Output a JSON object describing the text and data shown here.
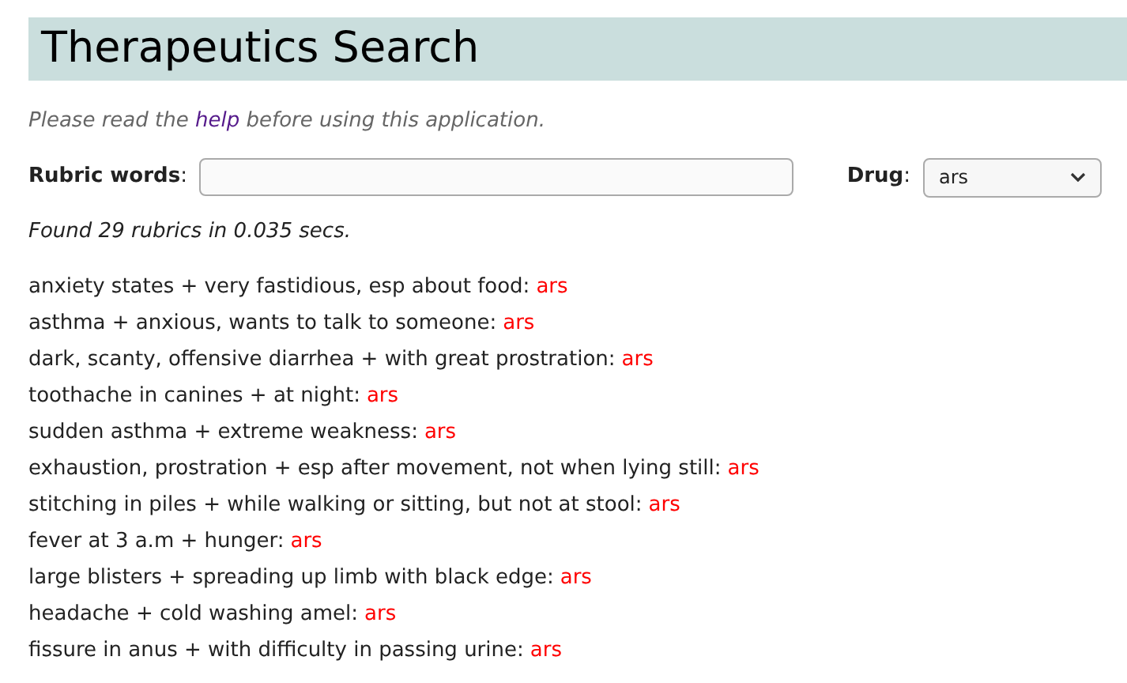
{
  "page_title": "Therapeutics Search",
  "notice": {
    "before": "Please read the",
    "link": "help",
    "after": "before using this application."
  },
  "search": {
    "label": "**Rubric words**:",
    "drug_label": "**Drug**:",
    "drug_value": "ars"
  },
  "result_summary": "Found 29 rubrics in 0.035 secs.",
  "rubrics": [
    {
      "text": "anxiety states + very fastidious, esp about food:",
      "drug": "ars"
    },
    {
      "text": "asthma + anxious, wants to talk to someone:",
      "drug": "ars"
    },
    {
      "text": "dark, scanty, offensive diarrhea + with great prostration:",
      "drug": "ars"
    },
    {
      "text": "toothache in canines + at night:",
      "drug": "ars"
    },
    {
      "text": "sudden asthma + extreme weakness:",
      "drug": "ars"
    },
    {
      "text": "exhaustion, prostration + esp after movement, not when lying still:",
      "drug": "ars"
    },
    {
      "text": "stitching in piles + while walking or sitting, but not at stool:",
      "drug": "ars"
    },
    {
      "text": "fever at 3 a.m + hunger:",
      "drug": "ars"
    },
    {
      "text": "large blisters + spreading up limb with black edge:",
      "drug": "ars"
    },
    {
      "text": "headache + cold washing amel:",
      "drug": "ars"
    },
    {
      "text": "fissure in anus + with difficulty in passing urine:",
      "drug": "ars"
    }
  ]
}
